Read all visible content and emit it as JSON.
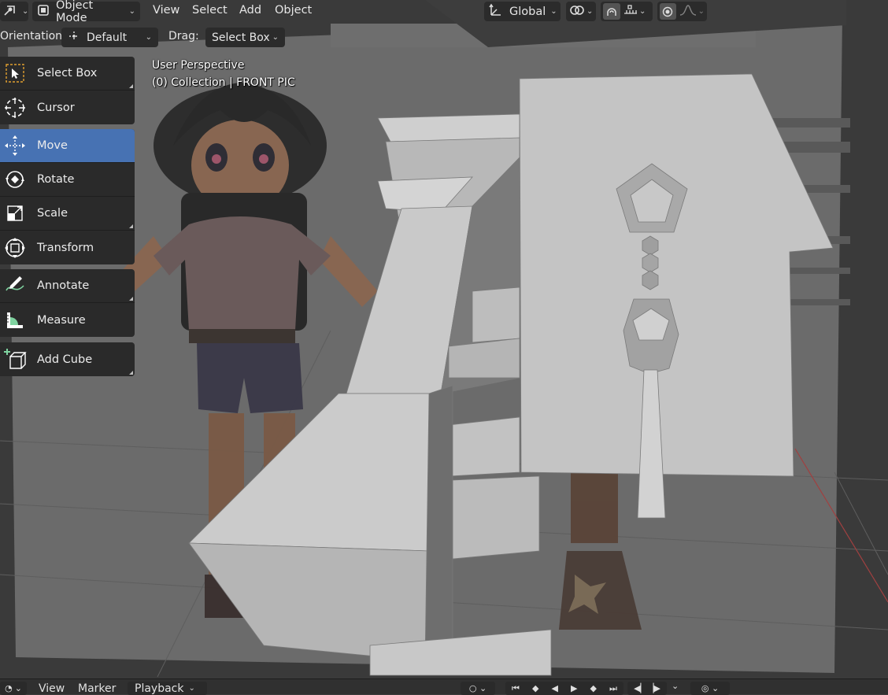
{
  "header": {
    "editor_type_icon": "viewport-editor-icon",
    "mode": {
      "label": "Object Mode",
      "icon": "object-mode-icon"
    },
    "menus": [
      "View",
      "Select",
      "Add",
      "Object"
    ],
    "transform_orientation": {
      "label": "Global",
      "icon": "transform-orientation-icon"
    },
    "pivot_icon": "pivot-point-icon",
    "snap_icon": "snap-magnet-icon",
    "snap_target_icon": "snap-increment-icon",
    "proportional_icon": "proportional-edit-icon",
    "falloff_icon": "falloff-curve-icon"
  },
  "tool_settings": {
    "orientation_label": "Orientation:",
    "orientation_value": "Default",
    "drag_label": "Drag:",
    "drag_value": "Select Box"
  },
  "toolbar": {
    "groups": [
      [
        {
          "label": "Select Box",
          "icon": "select-box-icon",
          "active": false,
          "has_more": true
        },
        {
          "label": "Cursor",
          "icon": "cursor-icon",
          "active": false,
          "has_more": false
        }
      ],
      [
        {
          "label": "Move",
          "icon": "move-icon",
          "active": true,
          "has_more": false
        },
        {
          "label": "Rotate",
          "icon": "rotate-icon",
          "active": false,
          "has_more": false
        },
        {
          "label": "Scale",
          "icon": "scale-icon",
          "active": false,
          "has_more": true
        },
        {
          "label": "Transform",
          "icon": "transform-icon",
          "active": false,
          "has_more": false
        }
      ],
      [
        {
          "label": "Annotate",
          "icon": "annotate-icon",
          "active": false,
          "has_more": true
        },
        {
          "label": "Measure",
          "icon": "measure-icon",
          "active": false,
          "has_more": false
        }
      ],
      [
        {
          "label": "Add Cube",
          "icon": "add-cube-icon",
          "active": false,
          "has_more": true
        }
      ]
    ]
  },
  "viewport": {
    "perspective_text": "User Perspective",
    "collection_text": "(0) Collection | FRONT PIC"
  },
  "timeline": {
    "menus": [
      "View",
      "Marker",
      "Playback"
    ],
    "playback_controls": [
      "jump-start-icon",
      "prev-keyframe-icon",
      "play-reverse-icon",
      "play-icon",
      "next-keyframe-icon",
      "jump-end-icon"
    ]
  },
  "colors": {
    "active_tool": "#4772b3",
    "panel": "#2a2a2a",
    "background": "#3d3d3d",
    "model_gray": "#bfbfbf"
  }
}
